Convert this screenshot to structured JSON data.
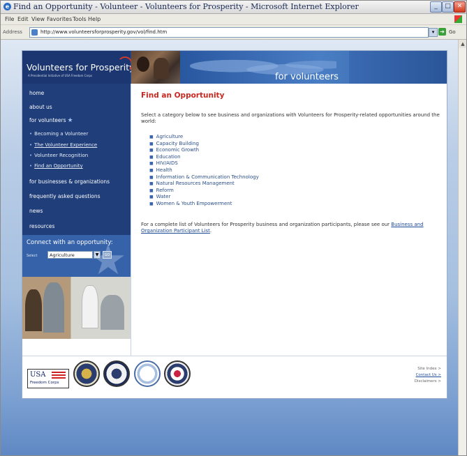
{
  "window": {
    "title": "Find an Opportunity - Volunteer - Volunteers for Prosperity - Microsoft Internet Explorer",
    "controls": {
      "minimize": "_",
      "maximize": "□",
      "close": "✕"
    }
  },
  "menubar": {
    "items": [
      "File",
      "Edit",
      "View",
      "Favorites",
      "Tools",
      "Help"
    ]
  },
  "addressbar": {
    "label": "Address",
    "url": "http://www.volunteersforprosperity.gov/vol/find.htm",
    "go_label": "Go"
  },
  "header": {
    "logo_main": "Volunteers for Prosperity",
    "logo_sub": "A Presidential Initiative of USA Freedom Corps",
    "caption": "for volunteers"
  },
  "sidebar": {
    "nav": [
      {
        "label": "home"
      },
      {
        "label": "about us"
      },
      {
        "label": "for volunteers"
      },
      {
        "label": "for businesses & organizations"
      },
      {
        "label": "frequently asked questions"
      },
      {
        "label": "news"
      },
      {
        "label": "resources"
      }
    ],
    "subnav": [
      {
        "label": "Becoming a Volunteer"
      },
      {
        "label": "The Volunteer Experience"
      },
      {
        "label": "Volunteer Recognition"
      },
      {
        "label": "Find an Opportunity"
      }
    ],
    "connect": {
      "title": "Connect with an opportunity:",
      "select_label": "Select",
      "selected": "Agriculture",
      "go": "GO"
    }
  },
  "main": {
    "title": "Find an Opportunity",
    "intro": "Select a category below to see business and organizations with Volunteers for Prosperity-related opportunities around the world:",
    "categories": [
      "Agriculture",
      "Capacity Building",
      "Economic Growth",
      "Education",
      "HIV/AIDS",
      "Health",
      "Information & Communication Technology",
      "Natural Resources Management",
      "Reform",
      "Water",
      "Women & Youth Empowerment"
    ],
    "outro_text": "For a complete list of Volunteers for Prosperity business and organization participants, please see our ",
    "outro_link": "Business and Organization Participant List",
    "outro_end": "."
  },
  "footer": {
    "usa_logo_text": "USA",
    "usa_logo_sub": "Freedom Corps",
    "links": [
      "Site Index >",
      "Contact Us >",
      "Disclaimers >"
    ]
  },
  "colors": {
    "nav_bg": "#1f3e7a",
    "title_red": "#c8281f",
    "link_blue": "#2a4e8a"
  }
}
